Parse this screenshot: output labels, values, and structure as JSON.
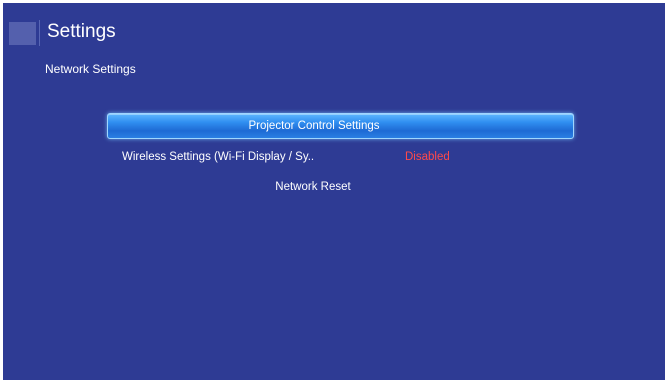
{
  "header": {
    "title": "Settings",
    "subtitle": "Network Settings"
  },
  "menu": {
    "items": [
      {
        "label": "Projector Control Settings",
        "value": ""
      },
      {
        "label": "Wireless Settings (Wi-Fi Display / Sy..",
        "value": "Disabled"
      },
      {
        "label": "Network Reset",
        "value": ""
      }
    ]
  },
  "colors": {
    "background": "#2e3b94",
    "focus_highlight": "#2f8ef0",
    "disabled_value": "#ff4a4a"
  }
}
